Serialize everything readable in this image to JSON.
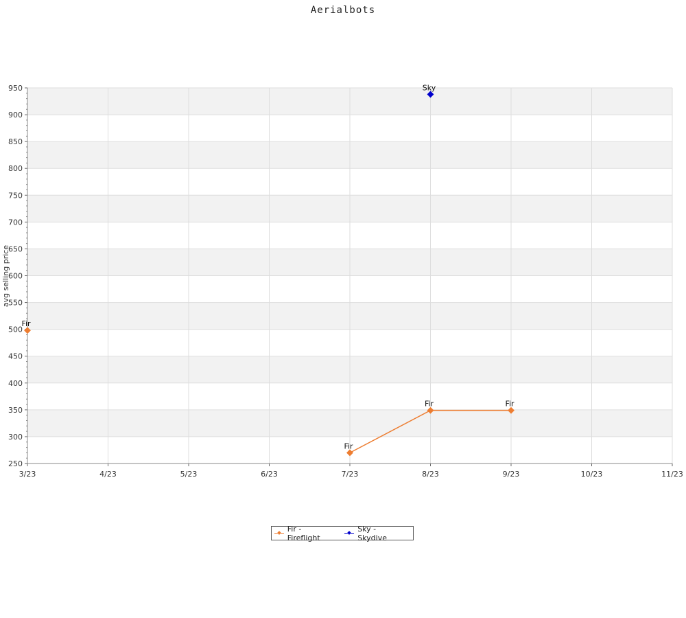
{
  "chart_data": {
    "type": "line",
    "title": "Aerialbots",
    "xlabel": "",
    "ylabel": "avg selling price",
    "x_ticks": [
      "3/23",
      "4/23",
      "5/23",
      "6/23",
      "7/23",
      "8/23",
      "9/23",
      "10/23",
      "11/23"
    ],
    "y_ticks": [
      250,
      300,
      350,
      400,
      450,
      500,
      550,
      600,
      650,
      700,
      750,
      800,
      850,
      900,
      950
    ],
    "ylim": [
      250,
      950
    ],
    "grid": true,
    "legend_position": "bottom-center",
    "series": [
      {
        "name": "Fir - Fireflight",
        "label": "Fir",
        "color": "#ed7d31",
        "segments": [
          [
            {
              "x": "3/23",
              "y": 498
            }
          ],
          [
            {
              "x": "7/23",
              "y": 270
            },
            {
              "x": "8/23",
              "y": 349
            },
            {
              "x": "9/23",
              "y": 349
            }
          ]
        ]
      },
      {
        "name": "Sky - Skydive",
        "label": "Sky",
        "color": "#0000cc",
        "segments": [
          [
            {
              "x": "8/23",
              "y": 938
            }
          ]
        ]
      }
    ]
  }
}
